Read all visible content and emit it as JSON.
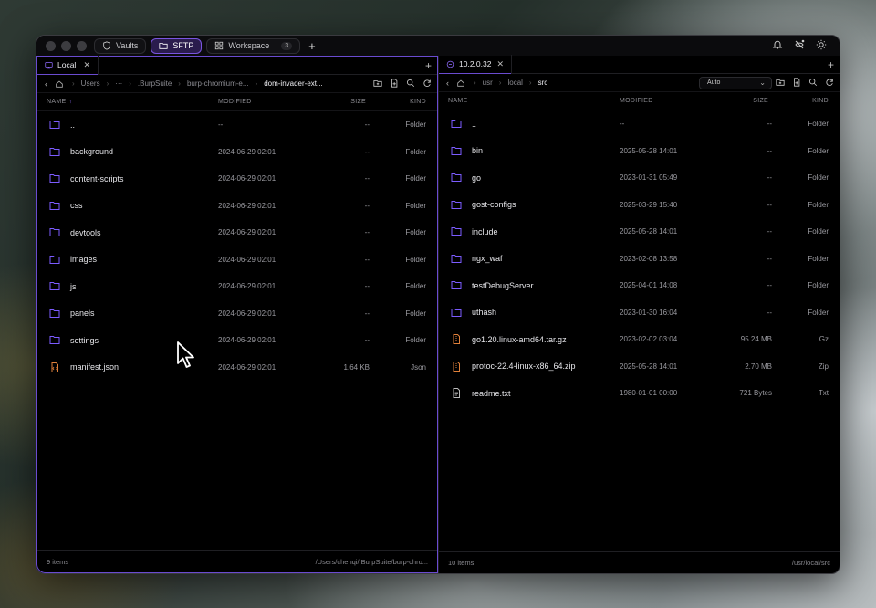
{
  "titlebar": {
    "tabs": [
      {
        "label": "Vaults",
        "icon": "shield-icon"
      },
      {
        "label": "SFTP",
        "icon": "folder-icon",
        "active": true
      },
      {
        "label": "Workspace",
        "icon": "grid-icon",
        "badge": "3"
      }
    ],
    "right_icons": [
      "bell-icon",
      "sync-off-icon",
      "sun-icon"
    ]
  },
  "left": {
    "tab_label": "Local",
    "breadcrumb": [
      "Users",
      "···",
      ".BurpSuite",
      "burp-chromium-e...",
      "dom-invader-ext..."
    ],
    "columns": {
      "name": "NAME",
      "modified": "MODIFIED",
      "size": "SIZE",
      "kind": "KIND"
    },
    "rows": [
      {
        "name": "..",
        "modified": "--",
        "size": "--",
        "kind": "Folder",
        "type": "folder"
      },
      {
        "name": "background",
        "modified": "2024-06-29 02:01",
        "size": "--",
        "kind": "Folder",
        "type": "folder"
      },
      {
        "name": "content-scripts",
        "modified": "2024-06-29 02:01",
        "size": "--",
        "kind": "Folder",
        "type": "folder"
      },
      {
        "name": "css",
        "modified": "2024-06-29 02:01",
        "size": "--",
        "kind": "Folder",
        "type": "folder"
      },
      {
        "name": "devtools",
        "modified": "2024-06-29 02:01",
        "size": "--",
        "kind": "Folder",
        "type": "folder"
      },
      {
        "name": "images",
        "modified": "2024-06-29 02:01",
        "size": "--",
        "kind": "Folder",
        "type": "folder"
      },
      {
        "name": "js",
        "modified": "2024-06-29 02:01",
        "size": "--",
        "kind": "Folder",
        "type": "folder"
      },
      {
        "name": "panels",
        "modified": "2024-06-29 02:01",
        "size": "--",
        "kind": "Folder",
        "type": "folder"
      },
      {
        "name": "settings",
        "modified": "2024-06-29 02:01",
        "size": "--",
        "kind": "Folder",
        "type": "folder"
      },
      {
        "name": "manifest.json",
        "modified": "2024-06-29 02:01",
        "size": "1.64 KB",
        "kind": "Json",
        "type": "code"
      }
    ],
    "status_count": "9 items",
    "status_path": "/Users/chenqi/.BurpSuite/burp-chro..."
  },
  "right": {
    "tab_label": "10.2.0.32",
    "breadcrumb": [
      "usr",
      "local",
      "src"
    ],
    "select_value": "Auto",
    "columns": {
      "name": "NAME",
      "modified": "MODIFIED",
      "size": "SIZE",
      "kind": "KIND"
    },
    "rows": [
      {
        "name": "..",
        "modified": "--",
        "size": "--",
        "kind": "Folder",
        "type": "folder"
      },
      {
        "name": "bin",
        "modified": "2025-05-28 14:01",
        "size": "--",
        "kind": "Folder",
        "type": "folder"
      },
      {
        "name": "go",
        "modified": "2023-01-31 05:49",
        "size": "--",
        "kind": "Folder",
        "type": "folder"
      },
      {
        "name": "gost-configs",
        "modified": "2025-03-29 15:40",
        "size": "--",
        "kind": "Folder",
        "type": "folder"
      },
      {
        "name": "include",
        "modified": "2025-05-28 14:01",
        "size": "--",
        "kind": "Folder",
        "type": "folder"
      },
      {
        "name": "ngx_waf",
        "modified": "2023-02-08 13:58",
        "size": "--",
        "kind": "Folder",
        "type": "folder"
      },
      {
        "name": "testDebugServer",
        "modified": "2025-04-01 14:08",
        "size": "--",
        "kind": "Folder",
        "type": "folder"
      },
      {
        "name": "uthash",
        "modified": "2023-01-30 16:04",
        "size": "--",
        "kind": "Folder",
        "type": "folder"
      },
      {
        "name": "go1.20.linux-amd64.tar.gz",
        "modified": "2023-02-02 03:04",
        "size": "95.24 MB",
        "kind": "Gz",
        "type": "archive"
      },
      {
        "name": "protoc-22.4-linux-x86_64.zip",
        "modified": "2025-05-28 14:01",
        "size": "2.70 MB",
        "kind": "Zip",
        "type": "archive"
      },
      {
        "name": "readme.txt",
        "modified": "1980-01-01 00:00",
        "size": "721 Bytes",
        "kind": "Txt",
        "type": "text"
      }
    ],
    "status_count": "10 items",
    "status_path": "/usr/local/src"
  },
  "colors": {
    "accent": "#7a55e0",
    "folder": "#7c5cff",
    "archive": "#e0803a",
    "code": "#e0803a",
    "text": "#bbbbbb"
  }
}
